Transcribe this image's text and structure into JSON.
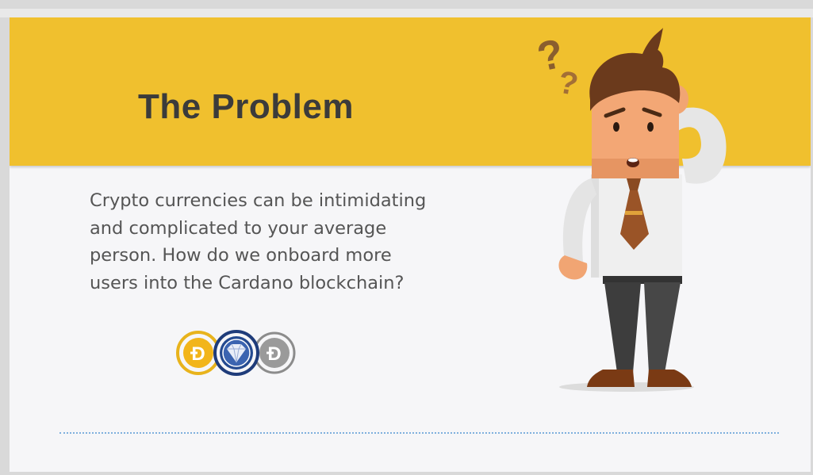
{
  "slide": {
    "title": "The Problem",
    "body": "Crypto currencies can be intimidating\nand complicated to your average\nperson.  How do we onboard more\nusers into the Cardano blockchain?",
    "coins": [
      "gold-dogecoin-icon",
      "diamond-token-icon",
      "silver-dogecoin-icon"
    ]
  },
  "colors": {
    "banner": "#f0c02e",
    "title": "#3b3b3b",
    "body_text": "#555555",
    "background": "#f6f6f8",
    "divider": "#7fb0dd"
  }
}
